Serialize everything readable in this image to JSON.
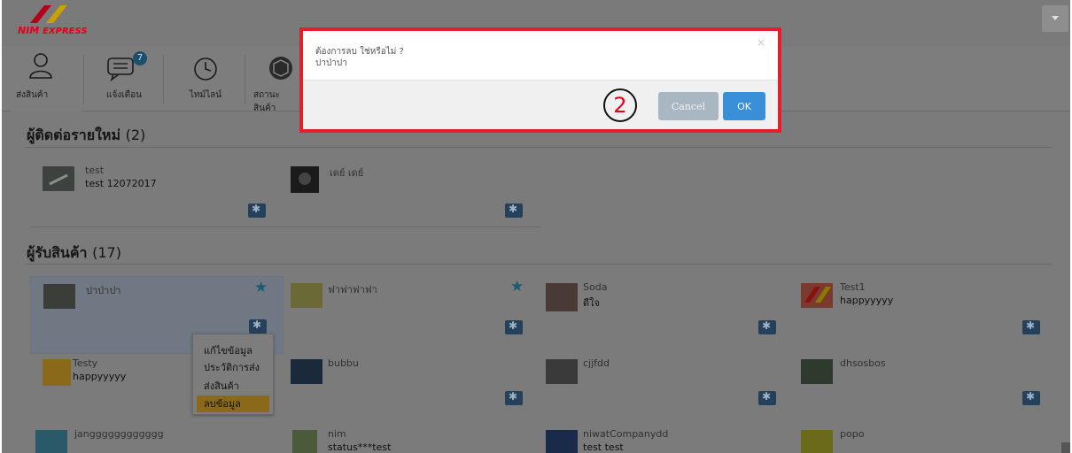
{
  "brand": {
    "logo_text": "NIM",
    "logo_sub": "EXPRESS"
  },
  "nav": [
    {
      "label": "ส่งสินค้า",
      "icon": "user-icon"
    },
    {
      "label": "แจ้งเตือน",
      "icon": "chat-icon",
      "badge": "7"
    },
    {
      "label": "ไทม์ไลน์",
      "icon": "clock-icon"
    },
    {
      "label": "สถานะสินค้า",
      "icon": "package-icon"
    }
  ],
  "sections": {
    "new_contacts": {
      "title": "ผู้ติดต่อรายใหม่",
      "count": "(2)"
    },
    "receivers": {
      "title": "ผู้รับสินค้า",
      "count": "(17)"
    }
  },
  "new_contacts": [
    {
      "name": "test",
      "status": "test 12072017"
    },
    {
      "name": "เดย์ เดย์",
      "status": ""
    }
  ],
  "receivers": [
    {
      "name": "ปาป่าปา",
      "status": ""
    },
    {
      "name": "ฟาฟาฟาฟา",
      "status": ""
    },
    {
      "name": "Soda",
      "status": "ดีใจ"
    },
    {
      "name": "Test1",
      "status": "happyyyyy"
    },
    {
      "name": "Testy",
      "status": "happyyyyy"
    },
    {
      "name": "bubbu",
      "status": ""
    },
    {
      "name": "cjjfdd",
      "status": ""
    },
    {
      "name": "dhsosbos",
      "status": ""
    },
    {
      "name": "jangggggggggggg",
      "status": ""
    },
    {
      "name": "nim",
      "status": "status***test"
    },
    {
      "name": "niwatCompanydd",
      "status": "test test"
    },
    {
      "name": "popo",
      "status": ""
    }
  ],
  "context_menu": {
    "items": [
      "แก้ไขข้อมูล",
      "ประวัติการส่ง",
      "ส่งสินค้า",
      "ลบข้อมูล"
    ]
  },
  "dialog": {
    "message": "ต้องการลบ ใช่หรือไม่ ?",
    "subject": "ปาป่าปา",
    "close": "×",
    "cancel_label": "Cancel",
    "ok_label": "OK",
    "step_number": "2"
  },
  "colors": {
    "dialog_border": "#e31e2d",
    "ok_button": "#3a8fd9",
    "cancel_button": "#a9b7c2",
    "menu_highlight": "#8a6a1a"
  }
}
